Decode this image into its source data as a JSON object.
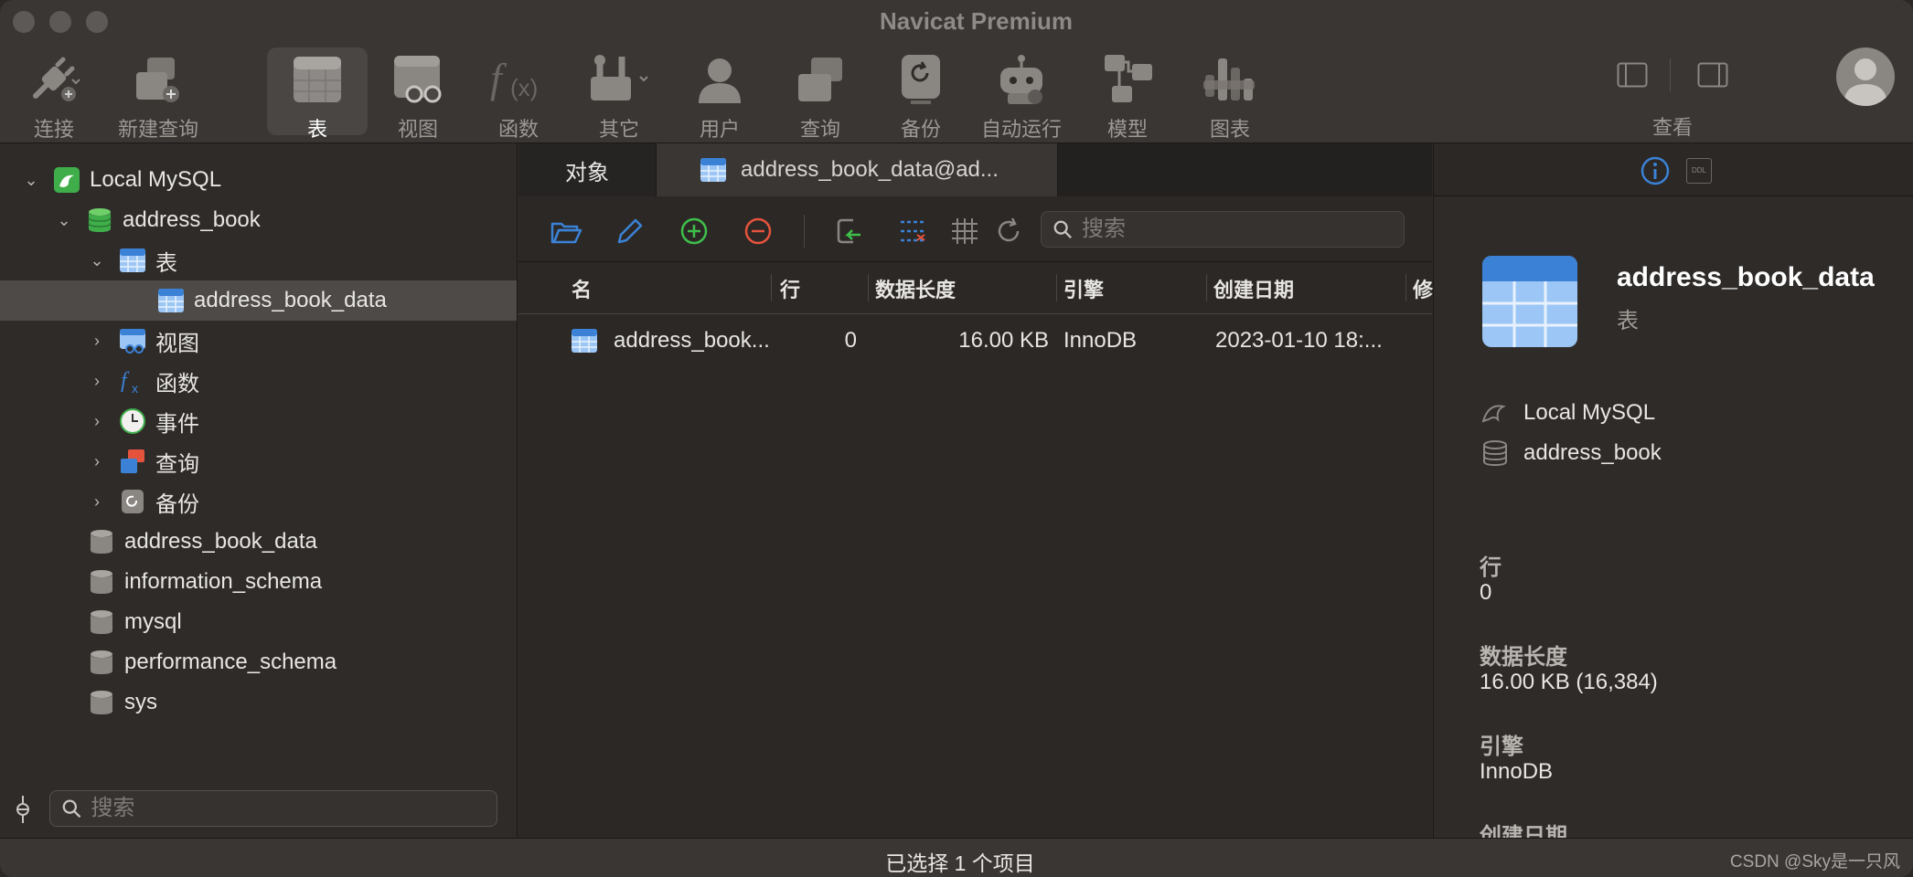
{
  "window": {
    "title": "Navicat Premium"
  },
  "toolbar": {
    "items": [
      {
        "label": "连接",
        "icon": "connection-icon"
      },
      {
        "label": "新建查询",
        "icon": "new-query-icon"
      },
      {
        "label": "表",
        "icon": "table-icon",
        "active": true
      },
      {
        "label": "视图",
        "icon": "view-icon"
      },
      {
        "label": "函数",
        "icon": "function-icon"
      },
      {
        "label": "其它",
        "icon": "tools-icon"
      },
      {
        "label": "用户",
        "icon": "user-icon"
      },
      {
        "label": "查询",
        "icon": "query-icon"
      },
      {
        "label": "备份",
        "icon": "backup-icon"
      },
      {
        "label": "自动运行",
        "icon": "robot-icon"
      },
      {
        "label": "模型",
        "icon": "model-icon"
      },
      {
        "label": "图表",
        "icon": "chart-icon"
      }
    ],
    "view_label": "查看"
  },
  "sidebar": {
    "connection": "Local MySQL",
    "database": "address_book",
    "tables_group": "表",
    "selected_table": "address_book_data",
    "groups": [
      "视图",
      "函数",
      "事件",
      "查询",
      "备份"
    ],
    "databases": [
      "address_book_data",
      "information_schema",
      "mysql",
      "performance_schema",
      "sys"
    ],
    "search_placeholder": "搜索"
  },
  "main": {
    "tabs": {
      "objects": "对象",
      "table": "address_book_data@ad..."
    },
    "search_placeholder": "搜索",
    "columns": [
      "名",
      "行",
      "数据长度",
      "引擎",
      "创建日期",
      "修"
    ],
    "rows": [
      {
        "name": "address_book...",
        "rows": "0",
        "data_length": "16.00 KB",
        "engine": "InnoDB",
        "created": "2023-01-10 18:..."
      }
    ]
  },
  "info": {
    "ddl_label": "DDL",
    "title": "address_book_data",
    "subtitle": "表",
    "connection": "Local MySQL",
    "database": "address_book",
    "rows_label": "行",
    "rows_value": "0",
    "data_length_label": "数据长度",
    "data_length_value": "16.00 KB (16,384)",
    "engine_label": "引擎",
    "engine_value": "InnoDB",
    "created_label": "创建日期"
  },
  "status": {
    "text": "已选择 1 个项目",
    "watermark": "CSDN @Sky是一只风"
  },
  "colors": {
    "accent_blue": "#3b82d6",
    "add_green": "#3fbf4a",
    "remove_red": "#e5533d"
  }
}
